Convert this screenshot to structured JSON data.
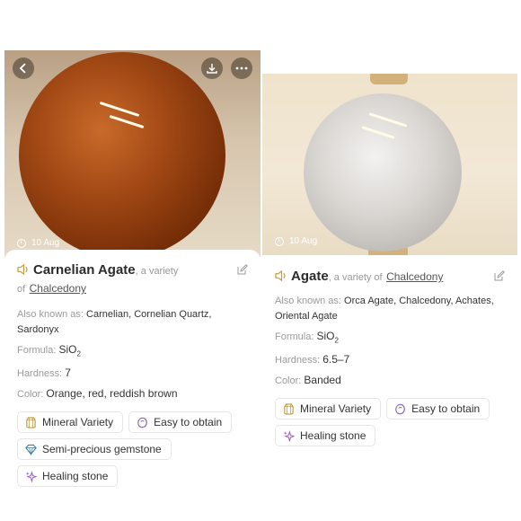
{
  "colors": {
    "accent": "#6a8fbf",
    "tag_border": "#e6e6e6",
    "muted": "#9a9a9a"
  },
  "left": {
    "date": "10 Aug",
    "name": "Carnelian Agate",
    "variety_text": ", a variety",
    "of_text": "of",
    "parent": "Chalcedony",
    "aka_label": "Also known as:",
    "aka_value": "Carnelian, Cornelian Quartz, Sardonyx",
    "formula_label": "Formula:",
    "formula_value": "SiO",
    "formula_sub": "2",
    "hardness_label": "Hardness:",
    "hardness_value": "7",
    "color_label": "Color:",
    "color_value": "Orange, red, reddish brown",
    "tags": [
      "Mineral Variety",
      "Easy to obtain",
      "Semi-precious gemstone",
      "Healing stone"
    ]
  },
  "right": {
    "date": "10 Aug",
    "name": "Agate",
    "variety_text": ", a variety of",
    "parent": "Chalcedony",
    "aka_label": "Also known as:",
    "aka_value": "Orca Agate, Chalcedony, Achates, Oriental Agate",
    "formula_label": "Formula:",
    "formula_value": "SiO",
    "formula_sub": "2",
    "hardness_label": "Hardness:",
    "hardness_value": "6.5–7",
    "color_label": "Color:",
    "color_value": "Banded",
    "tags": [
      "Mineral Variety",
      "Easy to obtain",
      "Healing stone"
    ]
  }
}
